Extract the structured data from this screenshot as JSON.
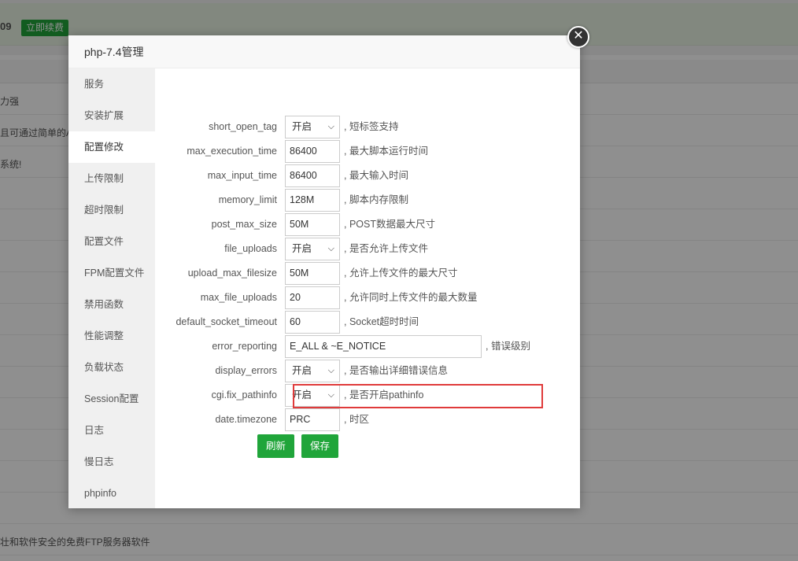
{
  "background": {
    "banner_text": "09",
    "renew_button": "立即续费",
    "rows": [
      "力强",
      "且可通过简单的A",
      "系统!",
      "壮和软件安全的免费FTP服务器软件"
    ]
  },
  "modal": {
    "title": "php-7.4管理",
    "close_icon": "close-icon",
    "sidebar": {
      "active_index": 2,
      "items": [
        {
          "label": "服务"
        },
        {
          "label": "安装扩展"
        },
        {
          "label": "配置修改"
        },
        {
          "label": "上传限制"
        },
        {
          "label": "超时限制"
        },
        {
          "label": "配置文件"
        },
        {
          "label": "FPM配置文件"
        },
        {
          "label": "禁用函数"
        },
        {
          "label": "性能调整"
        },
        {
          "label": "负载状态"
        },
        {
          "label": "Session配置"
        },
        {
          "label": "日志"
        },
        {
          "label": "慢日志"
        },
        {
          "label": "phpinfo"
        }
      ]
    },
    "form": {
      "fields": [
        {
          "name": "short_open_tag",
          "type": "select",
          "value": "开启",
          "desc": ", 短标签支持"
        },
        {
          "name": "max_execution_time",
          "type": "input",
          "value": "86400",
          "desc": ", 最大脚本运行时间"
        },
        {
          "name": "max_input_time",
          "type": "input",
          "value": "86400",
          "desc": ", 最大输入时间"
        },
        {
          "name": "memory_limit",
          "type": "input",
          "value": "128M",
          "desc": ", 脚本内存限制"
        },
        {
          "name": "post_max_size",
          "type": "input",
          "value": "50M",
          "desc": ", POST数据最大尺寸"
        },
        {
          "name": "file_uploads",
          "type": "select",
          "value": "开启",
          "desc": ", 是否允许上传文件"
        },
        {
          "name": "upload_max_filesize",
          "type": "input",
          "value": "50M",
          "desc": ", 允许上传文件的最大尺寸"
        },
        {
          "name": "max_file_uploads",
          "type": "input",
          "value": "20",
          "desc": ", 允许同时上传文件的最大数量"
        },
        {
          "name": "default_socket_timeout",
          "type": "input",
          "value": "60",
          "desc": ", Socket超时时间"
        },
        {
          "name": "error_reporting",
          "type": "input",
          "value": "E_ALL & ~E_NOTICE",
          "desc": ", 错误级别"
        },
        {
          "name": "display_errors",
          "type": "select",
          "value": "开启",
          "desc": ", 是否输出详细错误信息"
        },
        {
          "name": "cgi.fix_pathinfo",
          "type": "select",
          "value": "开启",
          "desc": ", 是否开启pathinfo"
        },
        {
          "name": "date.timezone",
          "type": "input",
          "value": "PRC",
          "desc": ", 时区"
        }
      ],
      "refresh_button": "刷新",
      "save_button": "保存"
    },
    "colors": {
      "accent": "#20a53a",
      "highlight": "#e03b3b"
    }
  }
}
